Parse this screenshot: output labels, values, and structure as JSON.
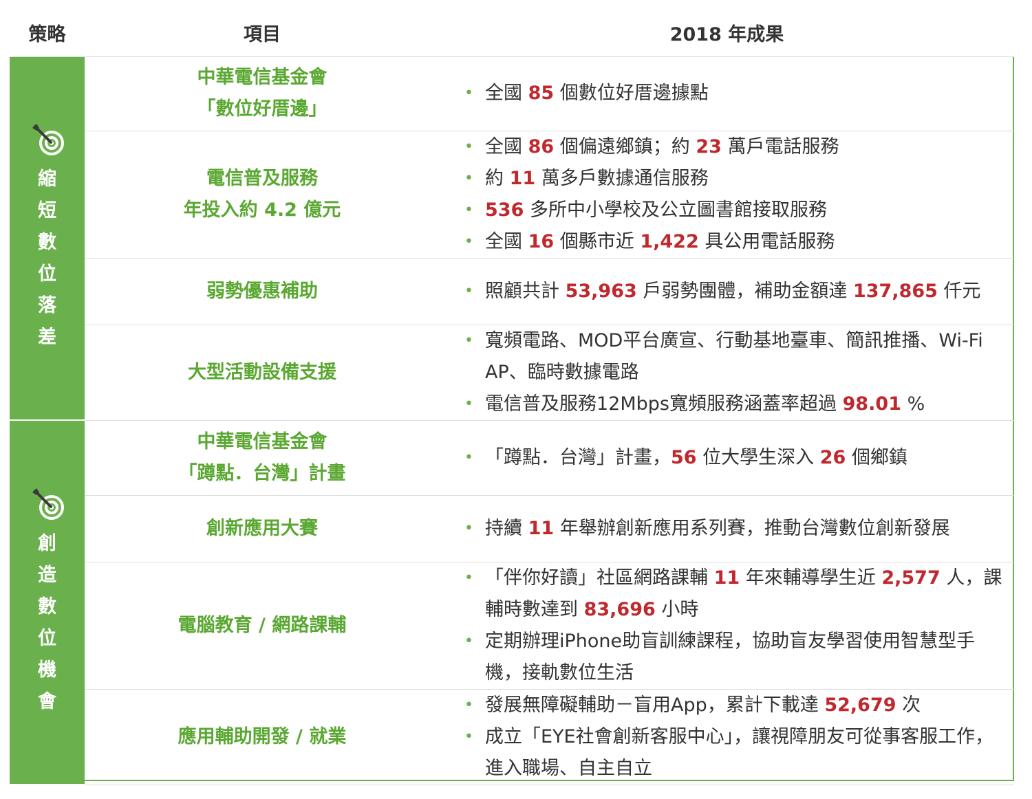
{
  "header": {
    "strategy": "策略",
    "item": "項目",
    "result": "2018 年成果"
  },
  "groups": [
    {
      "strategy_chars": [
        "縮",
        "短",
        "數",
        "位",
        "落",
        "差"
      ],
      "icon": "target-arrow-icon",
      "rows": [
        {
          "item_lines": [
            "中華電信基金會",
            "「數位好厝邊」"
          ],
          "bullets": [
            [
              {
                "t": "全國 "
              },
              {
                "t": "85",
                "h": true
              },
              {
                "t": " 個數位好厝邊據點"
              }
            ]
          ]
        },
        {
          "item_lines": [
            "電信普及服務",
            "年投入約 4.2 億元"
          ],
          "bullets": [
            [
              {
                "t": "全國 "
              },
              {
                "t": "86",
                "h": true
              },
              {
                "t": " 個偏遠鄉鎮；約 "
              },
              {
                "t": "23",
                "h": true
              },
              {
                "t": " 萬戶電話服務"
              }
            ],
            [
              {
                "t": "約 "
              },
              {
                "t": "11",
                "h": true
              },
              {
                "t": " 萬多戶數據通信服務"
              }
            ],
            [
              {
                "t": "536",
                "h": true
              },
              {
                "t": " 多所中小學校及公立圖書館接取服務"
              }
            ],
            [
              {
                "t": "全國 "
              },
              {
                "t": "16",
                "h": true
              },
              {
                "t": " 個縣市近 "
              },
              {
                "t": "1,422",
                "h": true
              },
              {
                "t": " 具公用電話服務"
              }
            ]
          ]
        },
        {
          "item_lines": [
            "弱勢優惠補助"
          ],
          "bullets": [
            [
              {
                "t": "照顧共計 "
              },
              {
                "t": "53,963",
                "h": true
              },
              {
                "t": " 戶弱勢團體，補助金額達 "
              },
              {
                "t": "137,865",
                "h": true
              },
              {
                "t": " 仟元"
              }
            ]
          ]
        },
        {
          "item_lines": [
            "大型活動設備支援"
          ],
          "bullets": [
            [
              {
                "t": "寬頻電路、MOD平台廣宣、行動基地臺車、簡訊推播、Wi-Fi AP、臨時數據電路"
              }
            ],
            [
              {
                "t": "電信普及服務12Mbps寬頻服務涵蓋率超過 "
              },
              {
                "t": "98.01",
                "h": true
              },
              {
                "t": " %"
              }
            ]
          ]
        }
      ]
    },
    {
      "strategy_chars": [
        "創",
        "造",
        "數",
        "位",
        "機",
        "會"
      ],
      "icon": "target-arrow-icon",
      "rows": [
        {
          "item_lines": [
            "中華電信基金會",
            "「蹲點．台灣」計畫"
          ],
          "bullets": [
            [
              {
                "t": "「蹲點．台灣」計畫，"
              },
              {
                "t": "56",
                "h": true
              },
              {
                "t": " 位大學生深入 "
              },
              {
                "t": "26",
                "h": true
              },
              {
                "t": " 個鄉鎮"
              }
            ]
          ]
        },
        {
          "item_lines": [
            "創新應用大賽"
          ],
          "bullets": [
            [
              {
                "t": "持續 "
              },
              {
                "t": "11",
                "h": true
              },
              {
                "t": " 年舉辦創新應用系列賽，推動台灣數位創新發展"
              }
            ]
          ]
        },
        {
          "item_lines": [
            "電腦教育 / 網路課輔"
          ],
          "bullets": [
            [
              {
                "t": "「伴你好讀」社區網路課輔 "
              },
              {
                "t": "11",
                "h": true
              },
              {
                "t": " 年來輔導學生近 "
              },
              {
                "t": "2,577",
                "h": true
              },
              {
                "t": " 人，課輔時數達到 "
              },
              {
                "t": "83,696",
                "h": true
              },
              {
                "t": " 小時"
              }
            ],
            [
              {
                "t": "定期辦理iPhone助盲訓練課程，協助盲友學習使用智慧型手機，接軌數位生活"
              }
            ]
          ]
        },
        {
          "item_lines": [
            "應用輔助開發 / 就業"
          ],
          "bullets": [
            [
              {
                "t": "發展無障礙輔助－盲用App，累計下載達 "
              },
              {
                "t": "52,679",
                "h": true
              },
              {
                "t": " 次"
              }
            ],
            [
              {
                "t": "成立「EYE社會創新客服中心」，讓視障朋友可從事客服工作，進入職場、自主自立"
              }
            ]
          ]
        }
      ]
    }
  ],
  "colors": {
    "green": "#6ab04c",
    "item_green": "#5aa832",
    "highlight_red": "#c0282e"
  }
}
